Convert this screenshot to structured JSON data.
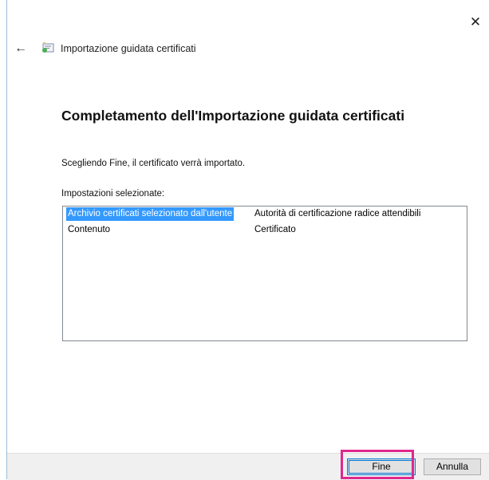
{
  "window": {
    "title": "Importazione guidata certificati",
    "close_glyph": "✕",
    "back_glyph": "←"
  },
  "main": {
    "heading": "Completamento dell'Importazione guidata certificati",
    "description": "Scegliendo Fine, il certificato verrà importato.",
    "settings_label": "Impostazioni selezionate:",
    "settings": [
      {
        "name": "Archivio certificati selezionato dall'utente",
        "value": "Autorità di certificazione radice attendibili",
        "selected": true
      },
      {
        "name": "Contenuto",
        "value": "Certificato",
        "selected": false
      }
    ]
  },
  "footer": {
    "finish_label": "Fine",
    "cancel_label": "Annulla"
  },
  "colors": {
    "selection": "#3399ff",
    "highlight": "#e0288c",
    "focus_border": "#0078d7"
  },
  "icons": {
    "back": "arrow-left-icon",
    "wizard": "certificate-icon",
    "close": "close-icon"
  }
}
